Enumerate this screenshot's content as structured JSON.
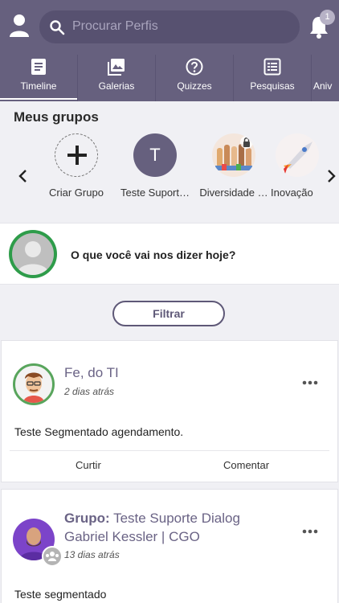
{
  "header": {
    "search_placeholder": "Procurar Perfis",
    "notifications_count": "1"
  },
  "tabs": [
    {
      "label": "Timeline",
      "icon": "timeline-icon",
      "active": true
    },
    {
      "label": "Galerias",
      "icon": "gallery-icon"
    },
    {
      "label": "Quizzes",
      "icon": "quiz-icon"
    },
    {
      "label": "Pesquisas",
      "icon": "survey-icon"
    },
    {
      "label": "Aniv",
      "icon": "birthday-icon"
    }
  ],
  "groups": {
    "title": "Meus grupos",
    "items": [
      {
        "label": "Criar Grupo"
      },
      {
        "label": "Teste Suport…",
        "initial": "T"
      },
      {
        "label": "Diversidade …"
      },
      {
        "label": "Inovação"
      }
    ]
  },
  "composer": {
    "prompt": "O que você vai nos dizer hoje?"
  },
  "filter": {
    "label": "Filtrar"
  },
  "posts": [
    {
      "author": "Fe, do TI",
      "time": "2 dias atrás",
      "body": "Teste Segmentado agendamento.",
      "like": "Curtir",
      "comment": "Comentar"
    },
    {
      "group_prefix": "Grupo:",
      "group_name": "Teste Suporte Dialog",
      "author": "Gabriel Kessler | CGO",
      "time": "13 dias atrás",
      "body": "Teste segmentado"
    }
  ],
  "colors": {
    "header": "#66607e",
    "accent": "#5e5877",
    "avatar_ring": "#2e9c4a"
  }
}
